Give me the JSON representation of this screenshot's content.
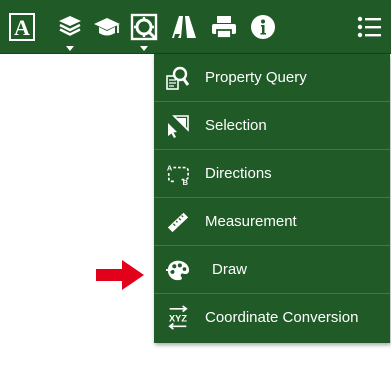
{
  "toolbar": {
    "background": "#1f5a27",
    "items": [
      {
        "icon": "text-a-icon"
      },
      {
        "icon": "layers-icon",
        "has_dropdown": true
      },
      {
        "icon": "graduation-cap-icon"
      },
      {
        "icon": "tools-icon",
        "has_dropdown": true,
        "active": true
      },
      {
        "icon": "map-road-icon"
      },
      {
        "icon": "printer-icon"
      },
      {
        "icon": "info-icon"
      },
      {
        "icon": "list-icon"
      }
    ]
  },
  "menu": {
    "background": "#1f5a27",
    "items": [
      {
        "label": "Property Query",
        "icon": "property-query-icon"
      },
      {
        "label": "Selection",
        "icon": "selection-icon"
      },
      {
        "label": "Directions",
        "icon": "directions-icon"
      },
      {
        "label": "Measurement",
        "icon": "ruler-icon"
      },
      {
        "label": "Draw",
        "icon": "palette-icon",
        "highlighted_by_arrow": true
      },
      {
        "label": "Coordinate Conversion",
        "icon": "xyz-conversion-icon"
      }
    ]
  },
  "annotation": {
    "arrow_color": "#e3001b",
    "arrow_icon": "red-right-arrow-icon"
  }
}
